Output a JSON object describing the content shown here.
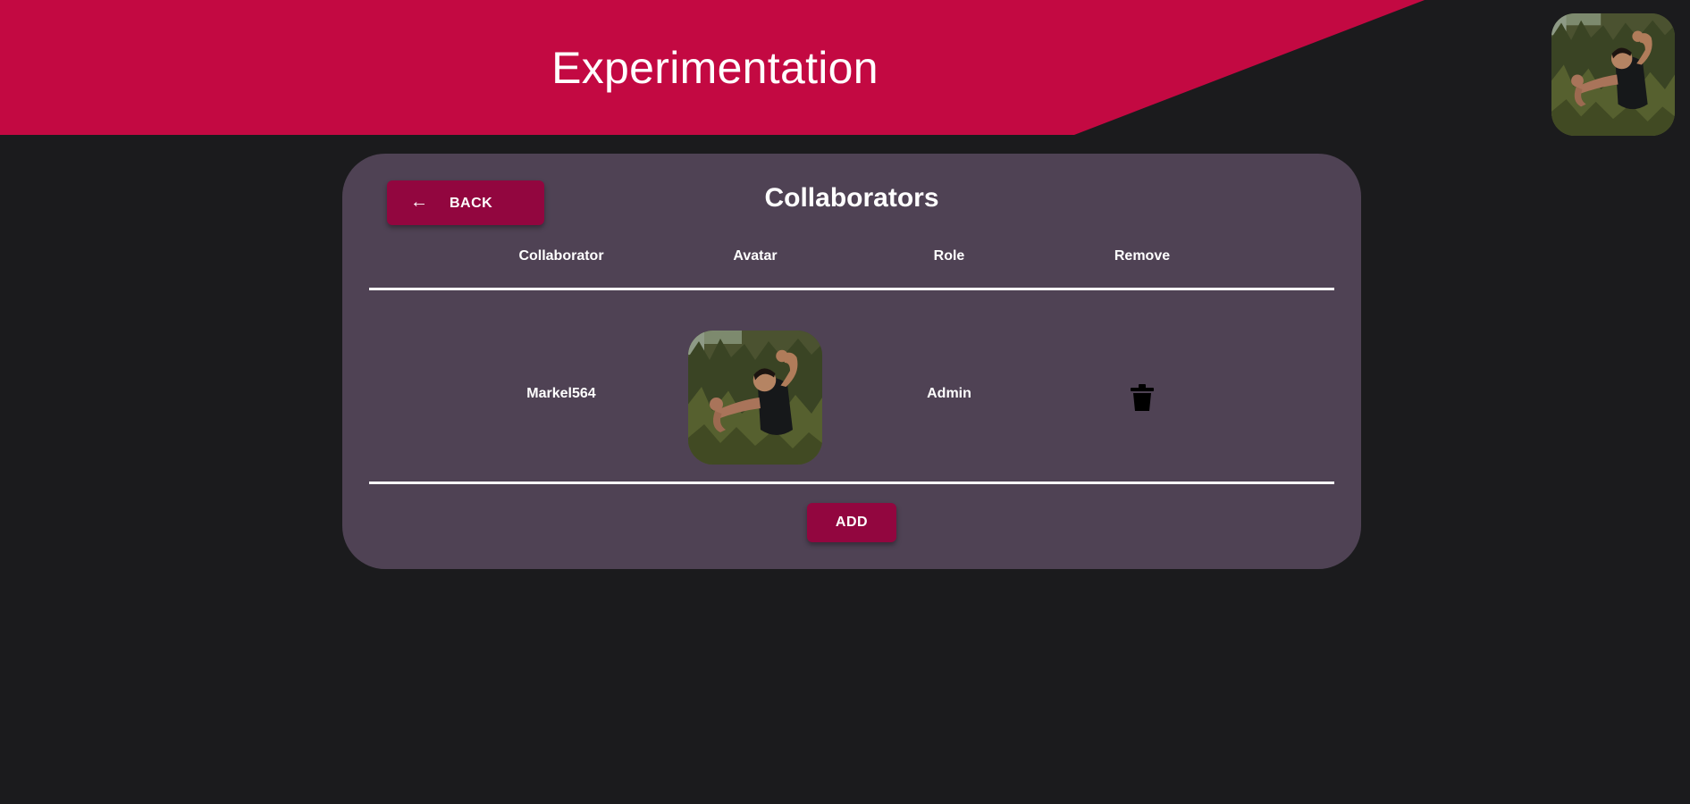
{
  "header": {
    "project_title": "Experimentation",
    "banner_color": "#c30942",
    "profile_avatar_icon": "user-photo"
  },
  "collaborators_panel": {
    "title": "Collaborators",
    "back_button": {
      "label": "BACK",
      "icon": "arrow-left-icon",
      "arrow_glyph": "←"
    },
    "columns": [
      "Collaborator",
      "Avatar",
      "Role",
      "Remove"
    ],
    "rows": [
      {
        "collaborator": "Markel564",
        "avatar_icon": "user-photo",
        "role": "Admin",
        "remove_icon": "trash-icon"
      }
    ],
    "add_button_label": "ADD"
  },
  "colors": {
    "background": "#1b1b1d",
    "card": "#4f4254",
    "button": "#92063f",
    "text": "#ffffff"
  }
}
